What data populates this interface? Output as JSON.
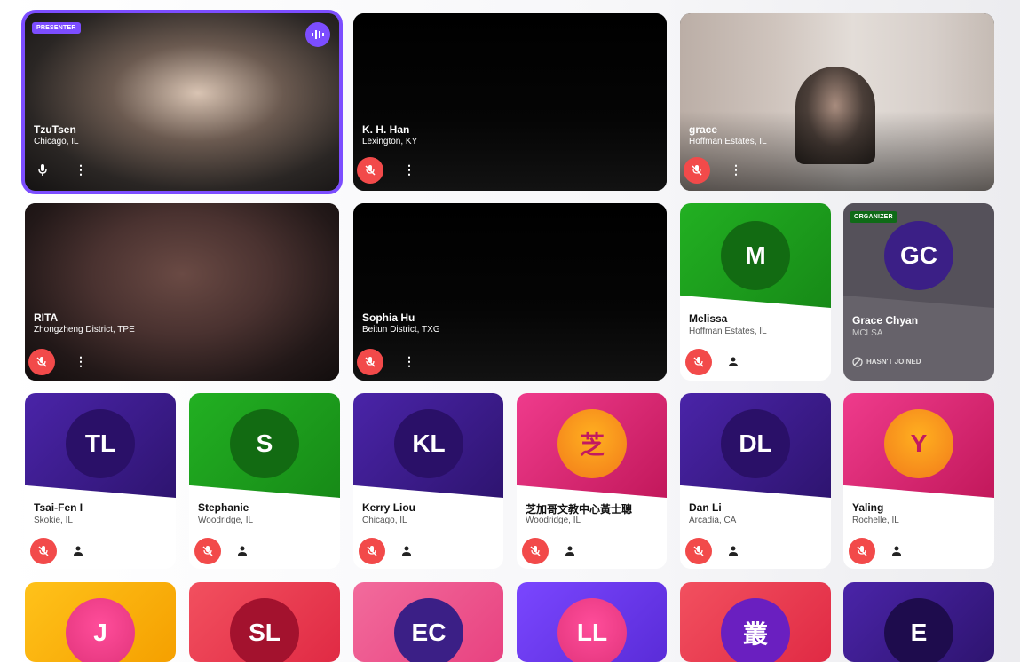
{
  "presenter_badge": "PRESENTER",
  "organizer_badge": "ORGANIZER",
  "row1": [
    {
      "name": "TzuTsen",
      "location": "Chicago, IL"
    },
    {
      "name": "K. H. Han",
      "location": "Lexington, KY"
    },
    {
      "name": "grace",
      "location": "Hoffman Estates, IL"
    }
  ],
  "row2": [
    {
      "name": "RITA",
      "location": "Zhongzheng District, TPE"
    },
    {
      "name": "Sophia Hu",
      "location": "Beitun District, TXG"
    },
    {
      "name": "Melissa",
      "location": "Hoffman Estates, IL",
      "initials": "M",
      "color": "#1e9e1e"
    },
    {
      "name": "Grace Chyan",
      "location": "MCLSA",
      "initials": "GC",
      "status": "HASN'T JOINED",
      "color": "#3b1f86"
    }
  ],
  "row3": [
    {
      "name": "Tsai-Fen I",
      "location": "Skokie, IL",
      "initials": "TL",
      "color": "#3c1c8c"
    },
    {
      "name": "Stephanie",
      "location": "Woodridge, IL",
      "initials": "S",
      "color": "#16a32a"
    },
    {
      "name": "Kerry Liou",
      "location": "Chicago, IL",
      "initials": "KL",
      "color": "#3c1c8c"
    },
    {
      "name": "芝加哥文教中心黃士聰",
      "location": "Woodridge, IL",
      "initials": "芝",
      "color": "#e0337a"
    },
    {
      "name": "Dan Li",
      "location": "Arcadia, CA",
      "initials": "DL",
      "color": "#3c1c8c"
    },
    {
      "name": "Yaling",
      "location": "Rochelle, IL",
      "initials": "Y",
      "color": "#e0337a"
    }
  ],
  "row4": [
    {
      "initials": "J",
      "color": "#f5b21a"
    },
    {
      "initials": "SL",
      "color": "#ef3b56"
    },
    {
      "initials": "EC",
      "color": "#e8427f"
    },
    {
      "initials": "LL",
      "color": "#6b3cf0"
    },
    {
      "initials": "叢",
      "color": "#ef3b56"
    },
    {
      "initials": "E",
      "color": "#3c1c8c"
    }
  ]
}
